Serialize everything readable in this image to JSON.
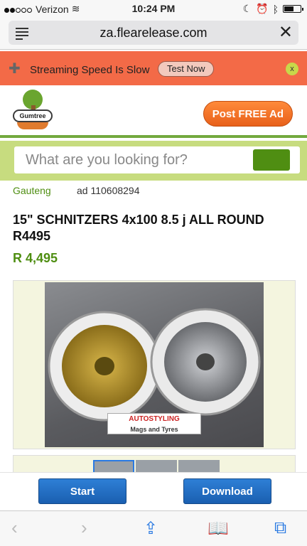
{
  "status_bar": {
    "carrier": "Verizon",
    "time": "10:24 PM"
  },
  "url_bar": {
    "url": "za.flearelease.com"
  },
  "banner": {
    "text": "Streaming Speed Is Slow",
    "button": "Test Now",
    "close": "x"
  },
  "header": {
    "logo_text": "Gumtree",
    "post_button": "Post FREE Ad"
  },
  "search": {
    "placeholder": "What are you looking for?"
  },
  "listing": {
    "location": "Gauteng",
    "ad_id": "ad 110608294",
    "title": "15\" SCHNITZERS 4x100 8.5 j ALL ROUND R4495",
    "price": "R 4,495",
    "photo_caption_line1": "AUTOSTYLING",
    "photo_caption_line2": "Mags and Tyres"
  },
  "bottom_buttons": {
    "start": "Start",
    "download": "Download"
  },
  "colors": {
    "accent_green": "#4f8e12",
    "banner_orange": "#f36a47",
    "button_blue": "#1a5fb0"
  }
}
